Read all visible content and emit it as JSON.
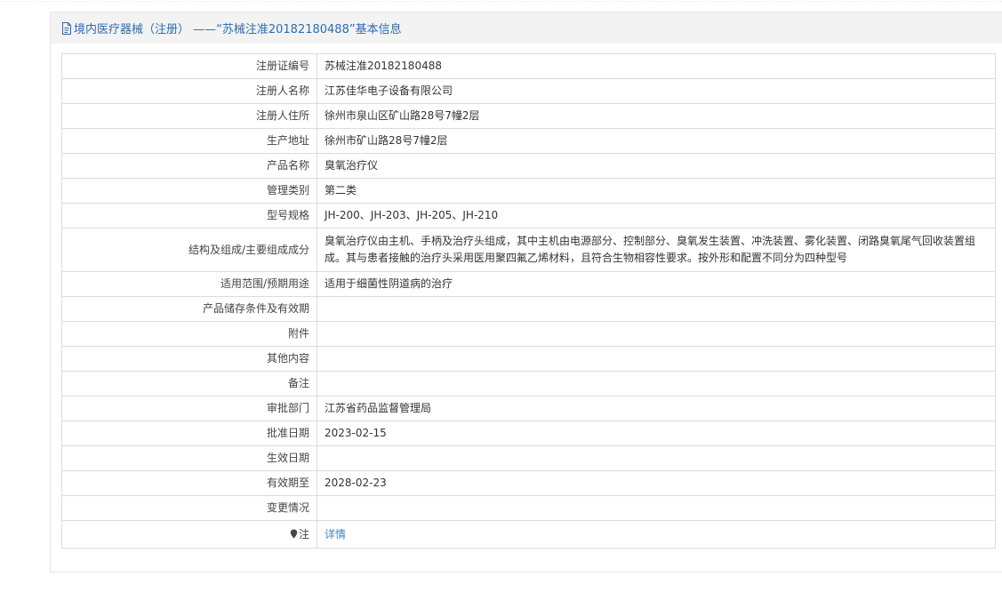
{
  "header": {
    "icon": "document-icon",
    "title": "境内医疗器械（注册） ——“苏械注准20182180488”基本信息"
  },
  "rows": [
    {
      "label": "注册证编号",
      "value": "苏械注准20182180488"
    },
    {
      "label": "注册人名称",
      "value": "江苏佳华电子设备有限公司"
    },
    {
      "label": "注册人住所",
      "value": "徐州市泉山区矿山路28号7幢2层"
    },
    {
      "label": "生产地址",
      "value": "徐州市矿山路28号7幢2层"
    },
    {
      "label": "产品名称",
      "value": "臭氧治疗仪"
    },
    {
      "label": "管理类别",
      "value": "第二类"
    },
    {
      "label": "型号规格",
      "value": "JH-200、JH-203、JH-205、JH-210"
    },
    {
      "label": "结构及组成/主要组成成分",
      "value": "臭氧治疗仪由主机、手柄及治疗头组成，其中主机由电源部分、控制部分、臭氧发生装置、冲洗装置、雾化装置、闭路臭氧尾气回收装置组成。其与患者接触的治疗头采用医用聚四氟乙烯材料，且符合生物相容性要求。按外形和配置不同分为四种型号"
    },
    {
      "label": "适用范围/预期用途",
      "value": "适用于细菌性阴道病的治疗"
    },
    {
      "label": "产品储存条件及有效期",
      "value": ""
    },
    {
      "label": "附件",
      "value": ""
    },
    {
      "label": "其他内容",
      "value": ""
    },
    {
      "label": "备注",
      "value": ""
    },
    {
      "label": "审批部门",
      "value": "江苏省药品监督管理局"
    },
    {
      "label": "批准日期",
      "value": "2023-02-15"
    },
    {
      "label": "生效日期",
      "value": ""
    },
    {
      "label": "有效期至",
      "value": "2028-02-23"
    },
    {
      "label": "变更情况",
      "value": ""
    }
  ],
  "note_row": {
    "icon": "pin-icon",
    "label": "注",
    "link_text": "详情"
  },
  "colors": {
    "header_text": "#2b6cb0",
    "header_bg": "#f3f3f3",
    "link": "#3b82c4",
    "border": "#dcdcdc"
  }
}
